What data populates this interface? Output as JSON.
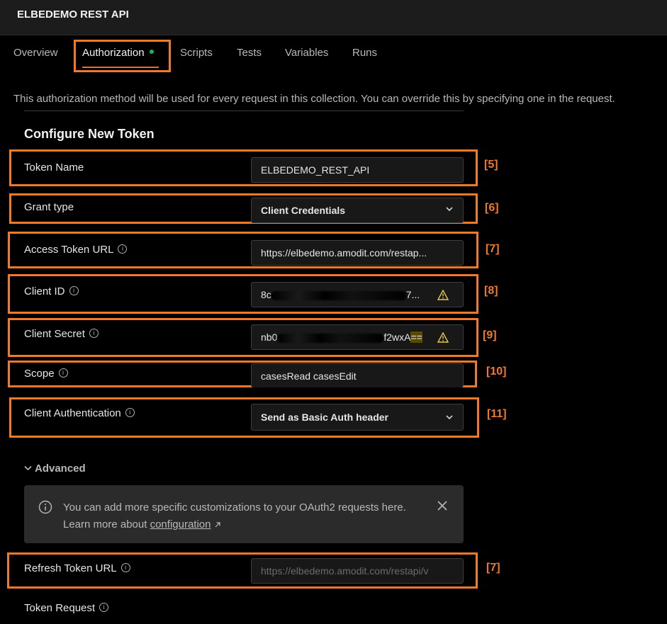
{
  "app": {
    "title": "ELBEDEMO REST API"
  },
  "tabs": [
    {
      "label": "Overview"
    },
    {
      "label": "Authorization"
    },
    {
      "label": "Scripts"
    },
    {
      "label": "Tests"
    },
    {
      "label": "Variables"
    },
    {
      "label": "Runs"
    }
  ],
  "description": "This authorization method will be used for every request in this collection. You can override this by specifying one in the request.",
  "section_title": "Configure New Token",
  "fields": {
    "token_name": {
      "label": "Token Name",
      "value": "ELBEDEMO_REST_API",
      "tag": "[5]"
    },
    "grant_type": {
      "label": "Grant type",
      "value": "Client Credentials",
      "tag": "[6]"
    },
    "access_token_url": {
      "label": "Access Token URL",
      "value": "https://elbedemo.amodit.com/restap...",
      "tag": "[7]"
    },
    "client_id": {
      "label": "Client ID",
      "value_start": "8c",
      "value_end": "7...",
      "tag": "[8]"
    },
    "client_secret": {
      "label": "Client Secret",
      "value_start": "nb0",
      "value_end": "f2wxA",
      "value_highlight": "==",
      "tag": "[9]"
    },
    "scope": {
      "label": "Scope",
      "value": "casesRead casesEdit",
      "tag": "[10]"
    },
    "client_auth": {
      "label": "Client Authentication",
      "value": "Send as Basic Auth header",
      "tag": "[11]"
    },
    "refresh_token_url": {
      "label": "Refresh Token URL",
      "placeholder": "https://elbedemo.amodit.com/restapi/v",
      "tag": "[7]"
    },
    "token_request": {
      "label": "Token Request"
    }
  },
  "advanced": {
    "label": "Advanced",
    "notice_text": "You can add more specific customizations to your OAuth2 requests here. Learn more about",
    "notice_link": "configuration"
  },
  "colors": {
    "accent": "#f07a2a",
    "status_dot": "#27ae60",
    "warning": "#e8c84a"
  }
}
